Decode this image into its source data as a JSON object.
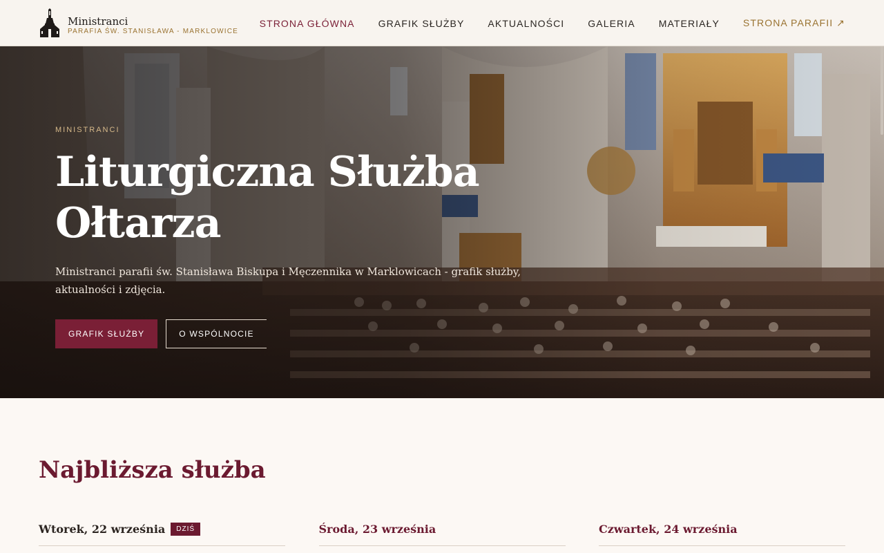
{
  "brand": {
    "title": "Ministranci",
    "subtitle": "PARAFIA ŚW. STANISŁAWA - MARKLOWICE",
    "logo_icon": "church-icon"
  },
  "nav": {
    "items": [
      {
        "label": "STRONA GŁÓWNA",
        "active": true
      },
      {
        "label": "GRAFIK SŁUŻBY"
      },
      {
        "label": "AKTUALNOŚCI"
      },
      {
        "label": "GALERIA"
      },
      {
        "label": "MATERIAŁY"
      },
      {
        "label": "STRONA PARAFII ↗",
        "external": true
      }
    ]
  },
  "hero": {
    "eyebrow": "MINISTRANCI",
    "title_line1": "Liturgiczna Służba",
    "title_line2": "Ołtarza",
    "description": "Ministranci parafii św. Stanisława Biskupa i Męczennika w Marklowicach - grafik służby, aktualności i zdjęcia.",
    "primary_button": "GRAFIK SŁUŻBY",
    "secondary_button": "O WSPÓLNOCIE"
  },
  "schedule": {
    "title": "Najbliższa służba",
    "days": [
      {
        "label": "Wtorek, 22 września",
        "badge": "DZIŚ"
      },
      {
        "label": "Środa, 23 września"
      },
      {
        "label": "Czwartek, 24 września"
      }
    ]
  },
  "colors": {
    "accent": "#7a1f36",
    "gold": "#9a7331",
    "background": "#fcf8f4"
  }
}
